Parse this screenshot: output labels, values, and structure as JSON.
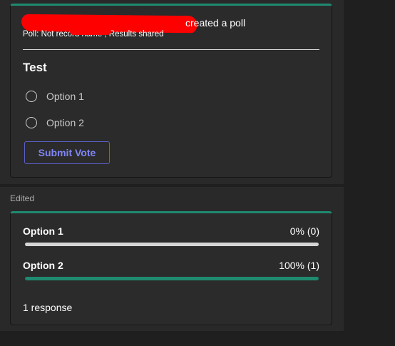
{
  "poll": {
    "creator_suffix": "created a poll",
    "meta": "Poll: Not record name , Results shared",
    "title": "Test",
    "options": [
      {
        "label": "Option 1"
      },
      {
        "label": "Option 2"
      }
    ],
    "submit_label": "Submit Vote"
  },
  "results": {
    "edited_label": "Edited",
    "options": [
      {
        "label": "Option 1",
        "pct_text": "0% (0)",
        "fraction": 0
      },
      {
        "label": "Option 2",
        "pct_text": "100% (1)",
        "fraction": 1
      }
    ],
    "responses": "1 response"
  },
  "colors": {
    "accent": "#1f8a70",
    "button_border": "#5b5fc7",
    "button_text": "#7f85f5",
    "redaction": "#ff0000"
  }
}
